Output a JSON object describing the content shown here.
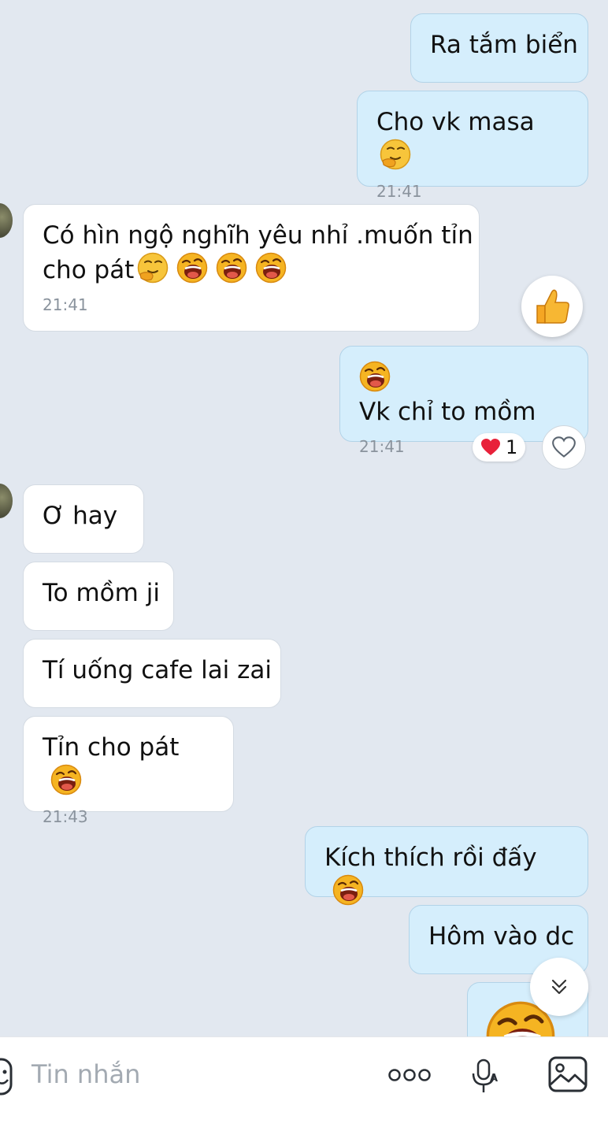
{
  "messages": [
    {
      "id": "m1",
      "side": "out",
      "text": "Ra tắm biển"
    },
    {
      "id": "m2",
      "side": "out",
      "text": "Cho vk masa",
      "emojis": [
        "thinking"
      ],
      "time": "21:41"
    },
    {
      "id": "m3",
      "side": "in",
      "line1": "Có hìn ngộ nghĩh yêu nhỉ .muốn tỉn",
      "line2": "cho pát",
      "emojis": [
        "thinking",
        "laughing",
        "laughing",
        "laughing"
      ],
      "time": "21:41",
      "reaction": "thumbs-up"
    },
    {
      "id": "m4",
      "side": "out",
      "text": "Vk chỉ to mồm",
      "emojis_before": [
        "laughing"
      ],
      "time": "21:41",
      "reaction": {
        "icon": "heart",
        "count": "1"
      }
    },
    {
      "id": "m5",
      "side": "in",
      "text": "Ơ hay"
    },
    {
      "id": "m6",
      "side": "in",
      "text": "To mồm ji"
    },
    {
      "id": "m7",
      "side": "in",
      "text": "Tí uống cafe lai zai"
    },
    {
      "id": "m8",
      "side": "in",
      "text": "Tỉn cho pát",
      "emojis": [
        "laughing"
      ],
      "time": "21:43"
    },
    {
      "id": "m9",
      "side": "out",
      "text": "Kích thích rồi đấy",
      "emojis": [
        "laughing"
      ]
    },
    {
      "id": "m10",
      "side": "out",
      "text": "Hôm vào dc"
    },
    {
      "id": "m11",
      "side": "out",
      "emojis": [
        "laughing"
      ],
      "partial": true
    }
  ],
  "composer": {
    "placeholder": "Tin nhắn",
    "icons": [
      "sticker-icon",
      "more-icon",
      "voice-text-icon",
      "image-icon"
    ]
  },
  "colors": {
    "background": "#e2e8f0",
    "outgoing_bubble": "#d5eefc",
    "incoming_bubble": "#ffffff",
    "timestamp": "#8a939d",
    "heart": "#e8213a"
  }
}
